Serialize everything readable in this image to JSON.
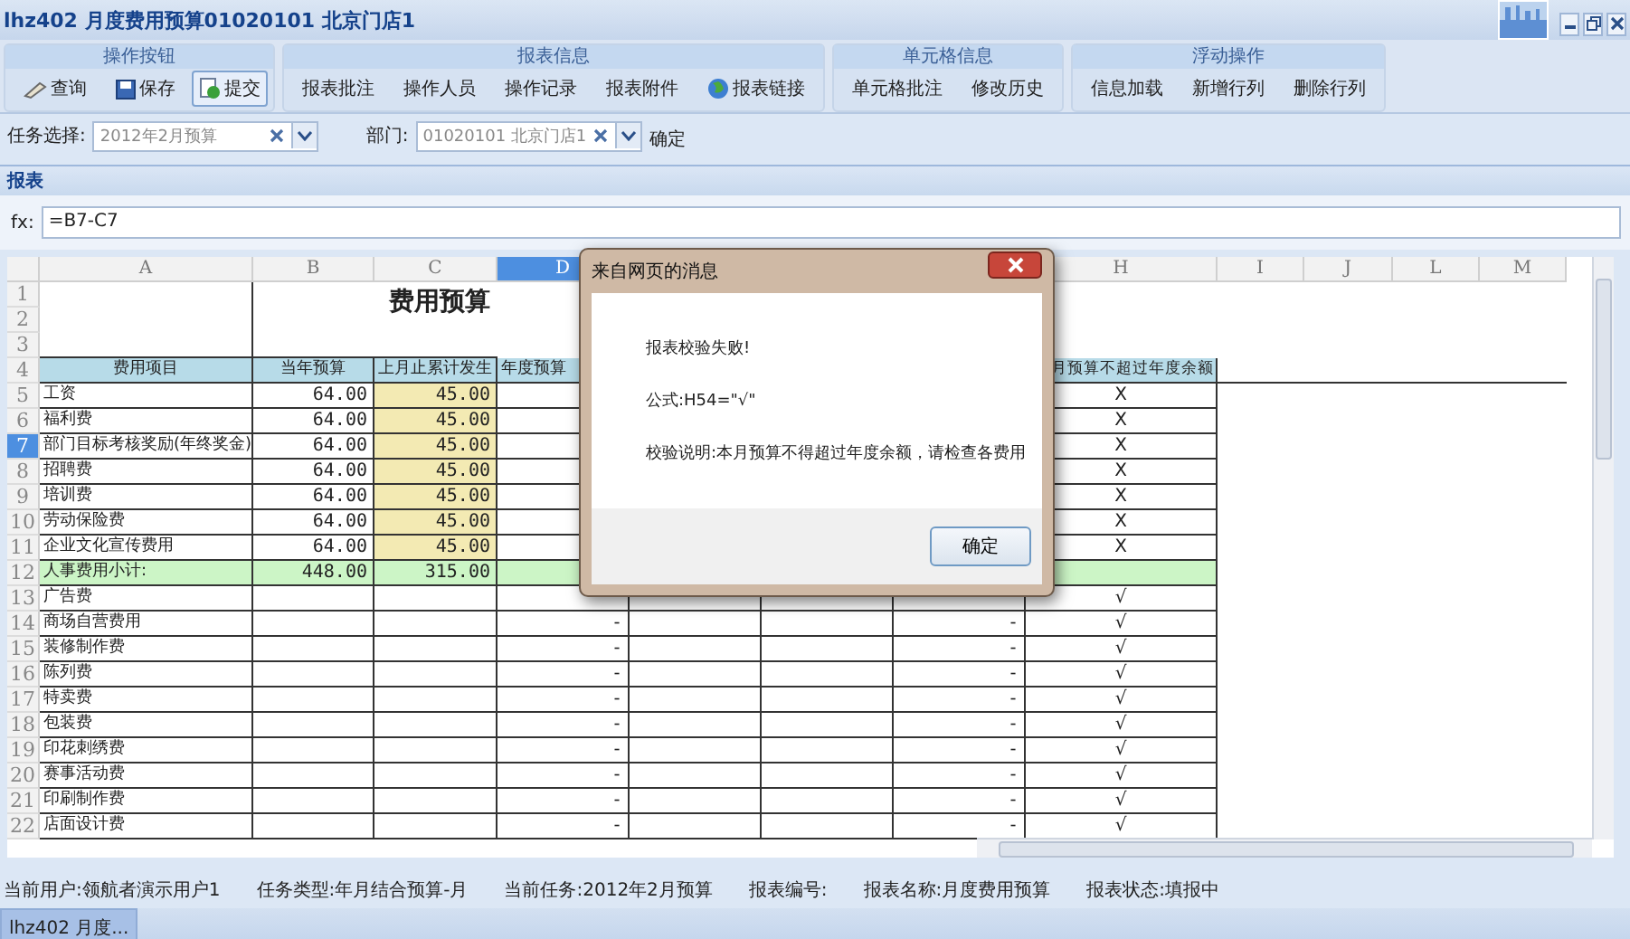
{
  "window": {
    "title": "lhz402 月度费用预算01020101 北京门店1"
  },
  "ribbon": {
    "groups": [
      {
        "title": "操作按钮",
        "buttons": [
          {
            "label": "查询",
            "pressed": false
          },
          {
            "label": "保存",
            "pressed": false
          },
          {
            "label": "提交",
            "pressed": true
          }
        ]
      },
      {
        "title": "报表信息",
        "buttons": [
          {
            "label": "报表批注",
            "pressed": false
          },
          {
            "label": "操作人员",
            "pressed": false
          },
          {
            "label": "操作记录",
            "pressed": false
          },
          {
            "label": "报表附件",
            "pressed": false
          },
          {
            "label": "报表链接",
            "pressed": false
          }
        ]
      },
      {
        "title": "单元格信息",
        "buttons": [
          {
            "label": "单元格批注",
            "pressed": false
          },
          {
            "label": "修改历史",
            "pressed": false
          }
        ]
      },
      {
        "title": "浮动操作",
        "buttons": [
          {
            "label": "信息加载",
            "pressed": false
          },
          {
            "label": "新增行列",
            "pressed": false
          },
          {
            "label": "删除行列",
            "pressed": false
          }
        ]
      }
    ]
  },
  "filters": [
    {
      "label": "任务选择:",
      "value": "2012年2月预算"
    },
    {
      "label": "部门:",
      "value": "01020101 北京门店1"
    }
  ],
  "confirm": "确定",
  "panel": {
    "title": "报表"
  },
  "formula": {
    "label": "fx:",
    "value": "=B7-C7"
  },
  "sheet": {
    "columns": [
      {
        "label": "A",
        "selected": false
      },
      {
        "label": "B",
        "selected": false
      },
      {
        "label": "C",
        "selected": false
      },
      {
        "label": "D",
        "selected": true
      },
      {
        "label": "H",
        "selected": false
      },
      {
        "label": "I",
        "selected": false
      },
      {
        "label": "J",
        "selected": false
      },
      {
        "label": "L",
        "selected": false
      },
      {
        "label": "M",
        "selected": false
      }
    ],
    "rows": [
      {
        "number": "1",
        "kind": "title",
        "selected": false,
        "title": "费用预算"
      },
      {
        "number": "2",
        "kind": "blank",
        "selected": false
      },
      {
        "number": "3",
        "kind": "blank",
        "selected": false
      },
      {
        "number": "4",
        "kind": "header",
        "selected": false,
        "A": "费用项目",
        "B": "当年预算",
        "C": "上月止累计发生",
        "D": "年度预算",
        "H": "月预算不超过年度余额"
      },
      {
        "number": "5",
        "kind": "personnel",
        "selected": false,
        "A": "工资",
        "B": "64.00",
        "C": "45.00",
        "H": "X"
      },
      {
        "number": "6",
        "kind": "personnel",
        "selected": false,
        "A": "福利费",
        "B": "64.00",
        "C": "45.00",
        "H": "X"
      },
      {
        "number": "7",
        "kind": "personnel",
        "selected": true,
        "A": "部门目标考核奖励(年终奖金)",
        "B": "64.00",
        "C": "45.00",
        "H": "X"
      },
      {
        "number": "8",
        "kind": "personnel",
        "selected": false,
        "A": "招聘费",
        "B": "64.00",
        "C": "45.00",
        "H": "X"
      },
      {
        "number": "9",
        "kind": "personnel",
        "selected": false,
        "A": "培训费",
        "B": "64.00",
        "C": "45.00",
        "H": "X"
      },
      {
        "number": "10",
        "kind": "personnel",
        "selected": false,
        "A": "劳动保险费",
        "B": "64.00",
        "C": "45.00",
        "H": "X"
      },
      {
        "number": "11",
        "kind": "personnel",
        "selected": false,
        "A": "企业文化宣传费用",
        "B": "64.00",
        "C": "45.00",
        "H": "X"
      },
      {
        "number": "12",
        "kind": "subtotal",
        "selected": false,
        "A": "人事费用小计:",
        "B": "448.00",
        "C": "315.00"
      },
      {
        "number": "13",
        "kind": "item",
        "selected": false,
        "A": "广告费",
        "H": "√"
      },
      {
        "number": "14",
        "kind": "item",
        "selected": false,
        "A": "商场自营费用",
        "D": "-",
        "G": "-",
        "H": "√"
      },
      {
        "number": "15",
        "kind": "item",
        "selected": false,
        "A": "装修制作费",
        "D": "-",
        "G": "-",
        "H": "√"
      },
      {
        "number": "16",
        "kind": "item",
        "selected": false,
        "A": "陈列费",
        "D": "-",
        "G": "-",
        "H": "√"
      },
      {
        "number": "17",
        "kind": "item",
        "selected": false,
        "A": "特卖费",
        "D": "-",
        "G": "-",
        "H": "√"
      },
      {
        "number": "18",
        "kind": "item",
        "selected": false,
        "A": "包装费",
        "D": "-",
        "G": "-",
        "H": "√"
      },
      {
        "number": "19",
        "kind": "item",
        "selected": false,
        "A": "印花刺绣费",
        "D": "-",
        "G": "-",
        "H": "√"
      },
      {
        "number": "20",
        "kind": "item",
        "selected": false,
        "A": "赛事活动费",
        "D": "-",
        "G": "-",
        "H": "√"
      },
      {
        "number": "21",
        "kind": "item",
        "selected": false,
        "A": "印刷制作费",
        "D": "-",
        "G": "-",
        "H": "√"
      },
      {
        "number": "22",
        "kind": "item",
        "selected": false,
        "A": "店面设计费",
        "D": "-",
        "G": "-",
        "H": "√"
      }
    ]
  },
  "dialog": {
    "title": "来自网页的消息",
    "message": "报表校验失败!",
    "formula": "公式:H54=\"√\"",
    "note": "校验说明:本月预算不得超过年度余额，请检查各费用",
    "button": "确定"
  },
  "status_bar": [
    {
      "label": "当前用户:",
      "value": "领航者演示用户1"
    },
    {
      "label": "任务类型:",
      "value": "年月结合预算-月"
    },
    {
      "label": "当前任务:",
      "value": "2012年2月预算"
    },
    {
      "label": "报表编号:"
    },
    {
      "label": "报表名称:",
      "value": "月度费用预算"
    },
    {
      "label": "报表状态:",
      "value": "填报中"
    }
  ],
  "taskbar": [
    {
      "label": "lhz402 月度...",
      "selected": true
    }
  ]
}
